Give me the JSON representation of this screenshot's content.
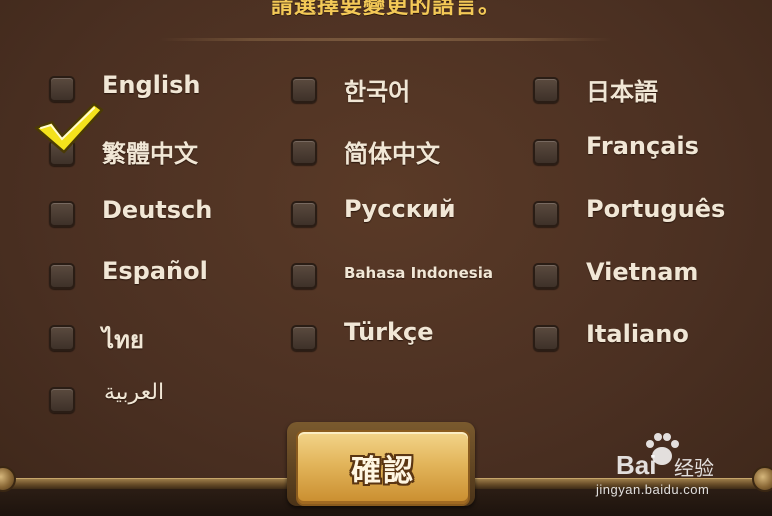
{
  "dialog": {
    "title": "請選擇要變更的語言。",
    "confirm_label": "確認"
  },
  "languages": [
    {
      "label": "English",
      "checked": false
    },
    {
      "label": "한국어",
      "checked": false
    },
    {
      "label": "日本語",
      "checked": false
    },
    {
      "label": "繁體中文",
      "checked": true
    },
    {
      "label": "简体中文",
      "checked": false
    },
    {
      "label": "Français",
      "checked": false
    },
    {
      "label": "Deutsch",
      "checked": false
    },
    {
      "label": "Русский",
      "checked": false
    },
    {
      "label": "Português",
      "checked": false
    },
    {
      "label": "Español",
      "checked": false
    },
    {
      "label": "Bahasa Indonesia",
      "checked": false
    },
    {
      "label": "Vietnam",
      "checked": false
    },
    {
      "label": "ไทย",
      "checked": false
    },
    {
      "label": "Türkçe",
      "checked": false
    },
    {
      "label": "Italiano",
      "checked": false
    },
    {
      "label": "العربية",
      "checked": false
    }
  ],
  "watermark": {
    "brand": "Bai",
    "brand_cn": "经验",
    "url": "jingyan.baidu.com"
  },
  "colors": {
    "title": "#f3c957",
    "label": "#f1e7d6",
    "background": "#4b3022",
    "checkmark": "#f4e21c",
    "button": "#e2b45a"
  }
}
